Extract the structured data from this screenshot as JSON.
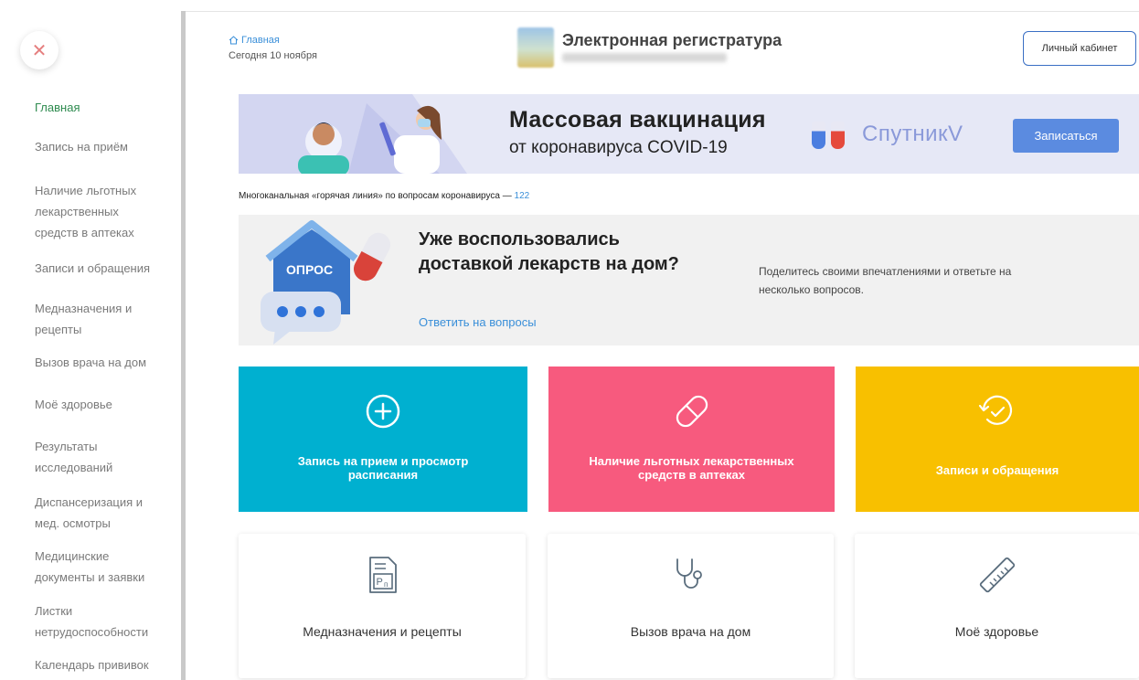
{
  "sidebar": {
    "items": [
      {
        "label": "Главная",
        "active": true
      },
      {
        "label": "Запись на приём"
      },
      {
        "label": "Наличие льготных лекарственных средств в аптеках"
      },
      {
        "label": "Записи и обращения"
      },
      {
        "label": "Медназначения и рецепты"
      },
      {
        "label": "Вызов врача на дом"
      },
      {
        "label": "Моё здоровье"
      },
      {
        "label": "Результаты исследований"
      },
      {
        "label": "Диспансеризация и мед. осмотры"
      },
      {
        "label": "Медицинские документы и заявки"
      },
      {
        "label": "Листки нетрудоспособности"
      },
      {
        "label": "Календарь прививок"
      }
    ]
  },
  "header": {
    "breadcrumb": "Главная",
    "today": "Сегодня 10 ноября",
    "title": "Электронная регистратура",
    "cabinet_button": "Личный кабинет"
  },
  "vaccination_banner": {
    "title": "Массовая вакцинация",
    "subtitle": "от коронавируса COVID-19",
    "brand": "СпутникV",
    "button": "Записаться"
  },
  "hotline": {
    "text": "Многоканальная «горячая линия» по вопросам коронавируса —",
    "number": "122"
  },
  "survey_banner": {
    "badge": "ОПРОС",
    "title": "Уже воспользовались доставкой лекарств на дом?",
    "link": "Ответить на вопросы",
    "note": "Поделитесь своими впечатлениями и ответьте на несколько вопросов."
  },
  "tiles": [
    {
      "label": "Запись на прием и просмотр расписания",
      "icon": "plus-circle-icon",
      "color": "#00b0d0"
    },
    {
      "label": "Наличие льготных лекарственных средств в аптеках",
      "icon": "pill-icon",
      "color": "#f75a7e"
    },
    {
      "label": "Записи и обращения",
      "icon": "history-icon",
      "color": "#f8c000"
    },
    {
      "label": "Медназначения и рецепты",
      "icon": "prescription-icon"
    },
    {
      "label": "Вызов врача на дом",
      "icon": "stethoscope-icon"
    },
    {
      "label": "Моё здоровье",
      "icon": "ruler-icon"
    }
  ],
  "colors": {
    "accent_blue": "#3a8fd9",
    "active_nav": "#2e8b4f",
    "icon_gray": "#5a6d7d"
  }
}
